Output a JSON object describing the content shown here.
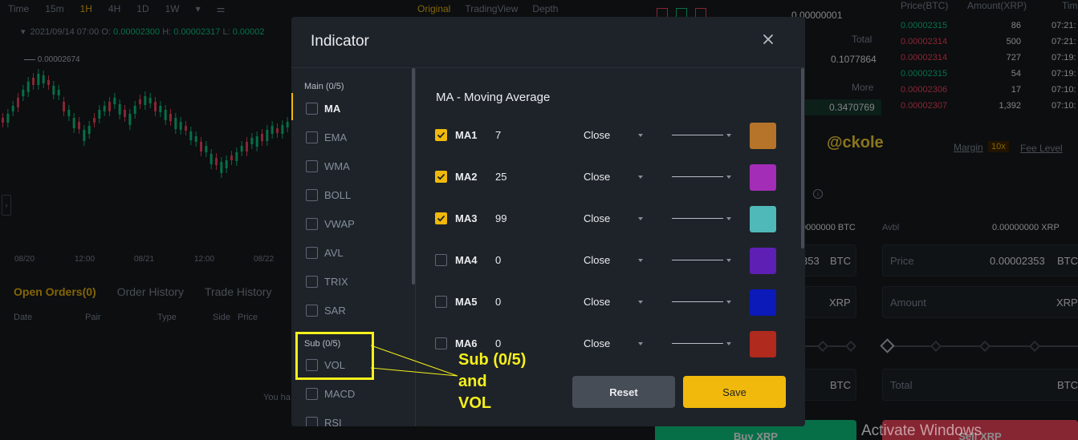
{
  "toolbar": {
    "items": [
      "Time",
      "15m",
      "1H",
      "4H",
      "1D",
      "1W"
    ],
    "active": "1H",
    "view_tabs": [
      "Original",
      "TradingView",
      "Depth"
    ]
  },
  "ohlc": {
    "date": "2021/09/14 07:00",
    "o_label": "O:",
    "o": "0.00002300",
    "h_label": "H:",
    "h": "0.00002317",
    "l_label": "L:",
    "l": "0.00002"
  },
  "chart": {
    "high_label": "0.00002674",
    "x_ticks": [
      "08/20",
      "12:00",
      "08/21",
      "12:00",
      "08/22"
    ]
  },
  "orders": {
    "tabs": [
      "Open Orders(0)",
      "Order History",
      "Trade History"
    ],
    "headers": [
      "Date",
      "Pair",
      "Type",
      "Side",
      "Price"
    ],
    "empty_text": "You ha"
  },
  "orderbook": {
    "precision": "0.00000001",
    "total_label": "Total",
    "value1": "0.1077864",
    "more_label": "More",
    "value2": "0.3470769"
  },
  "trades": {
    "headers": [
      "Price(BTC)",
      "Amount(XRP)",
      "Tim"
    ],
    "rows": [
      {
        "price": "0.00002315",
        "amount": "86",
        "time": "07:21:",
        "side": "buy"
      },
      {
        "price": "0.00002314",
        "amount": "500",
        "time": "07:21:",
        "side": "sell"
      },
      {
        "price": "0.00002314",
        "amount": "727",
        "time": "07:19:",
        "side": "sell"
      },
      {
        "price": "0.00002315",
        "amount": "54",
        "time": "07:19:",
        "side": "buy"
      },
      {
        "price": "0.00002306",
        "amount": "17",
        "time": "07:10:",
        "side": "sell"
      },
      {
        "price": "0.00002307",
        "amount": "1,392",
        "time": "07:10:",
        "side": "sell"
      }
    ]
  },
  "watermark": "@ckole",
  "trade_form": {
    "margin_label": "Margin",
    "leverage": "10x",
    "fee_label": "Fee Level",
    "avbl_left": "0000000 BTC",
    "avbl_label": "Avbl",
    "avbl_right": "0.00000000 XRP",
    "left_price_value": "353",
    "left_price_unit": "BTC",
    "left_amount_unit": "XRP",
    "left_total_unit": "BTC",
    "price_label": "Price",
    "price_value": "0.00002353",
    "price_unit": "BTC",
    "amount_label": "Amount",
    "amount_unit": "XRP",
    "total_label": "Total",
    "total_unit": "BTC",
    "buy_label": "Buy XRP",
    "sell_label": "Sell XRP"
  },
  "activate_windows": "Activate Windows",
  "modal": {
    "title": "Indicator",
    "main_label": "Main (0/5)",
    "main_items": [
      "MA",
      "EMA",
      "WMA",
      "BOLL",
      "VWAP",
      "AVL",
      "TRIX",
      "SAR"
    ],
    "sub_label": "Sub (0/5)",
    "sub_items": [
      "VOL",
      "MACD",
      "RSI"
    ],
    "detail_title": "MA - Moving Average",
    "ma_rows": [
      {
        "name": "MA1",
        "value": "7",
        "source": "Close",
        "checked": true,
        "color": "#b5742a"
      },
      {
        "name": "MA2",
        "value": "25",
        "source": "Close",
        "checked": true,
        "color": "#a42db8"
      },
      {
        "name": "MA3",
        "value": "99",
        "source": "Close",
        "checked": true,
        "color": "#4fb8b8"
      },
      {
        "name": "MA4",
        "value": "0",
        "source": "Close",
        "checked": false,
        "color": "#5d1fb4"
      },
      {
        "name": "MA5",
        "value": "0",
        "source": "Close",
        "checked": false,
        "color": "#0b1ab8"
      },
      {
        "name": "MA6",
        "value": "0",
        "source": "Close",
        "checked": false,
        "color": "#b02a1e"
      }
    ],
    "reset_label": "Reset",
    "save_label": "Save"
  },
  "annotation": {
    "line1": "Sub (0/5)",
    "line2": "and",
    "line3": "VOL"
  }
}
